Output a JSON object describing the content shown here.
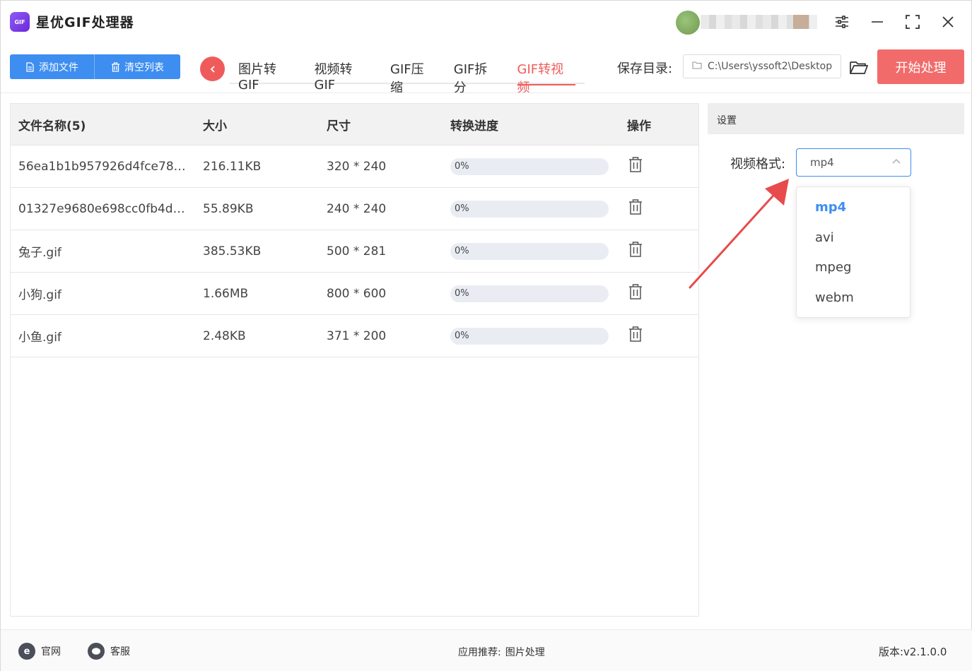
{
  "app": {
    "title": "星优GIF处理器",
    "logo_text": "GIF"
  },
  "toolbar": {
    "add_label": "添加文件",
    "clear_label": "清空列表",
    "tabs": [
      {
        "label": "图片转GIF",
        "active": false
      },
      {
        "label": "视频转GIF",
        "active": false
      },
      {
        "label": "GIF压缩",
        "active": false
      },
      {
        "label": "GIF拆分",
        "active": false
      },
      {
        "label": "GIF转视频",
        "active": true
      }
    ],
    "save_label": "保存目录:",
    "save_path": "C:\\Users\\yssoft2\\Desktop",
    "start_label": "开始处理"
  },
  "table": {
    "headers": {
      "name": "文件名称(5)",
      "size": "大小",
      "dim": "尺寸",
      "progress": "转换进度",
      "op": "操作"
    },
    "rows": [
      {
        "name": "56ea1b1b957926d4fce7820...",
        "size": "216.11KB",
        "dim": "320 * 240",
        "progress_text": "0%",
        "progress": 0
      },
      {
        "name": "01327e9680e698cc0fb4dd95...",
        "size": "55.89KB",
        "dim": "240 * 240",
        "progress_text": "0%",
        "progress": 0
      },
      {
        "name": "兔子.gif",
        "size": "385.53KB",
        "dim": "500 * 281",
        "progress_text": "0%",
        "progress": 0
      },
      {
        "name": "小狗.gif",
        "size": "1.66MB",
        "dim": "800 * 600",
        "progress_text": "0%",
        "progress": 0
      },
      {
        "name": "小鱼.gif",
        "size": "2.48KB",
        "dim": "371 * 200",
        "progress_text": "0%",
        "progress": 0
      }
    ]
  },
  "settings": {
    "header": "设置",
    "format_label": "视频格式:",
    "format_value": "mp4",
    "format_options": [
      "mp4",
      "avi",
      "mpeg",
      "webm"
    ]
  },
  "footer": {
    "website": "官网",
    "support": "客服",
    "recommend_label": "应用推荐:",
    "recommend_link": "图片处理",
    "version": "版本:v2.1.0.0"
  },
  "colors": {
    "accent_blue": "#3d8ef0",
    "accent_red": "#ef5b5b",
    "start_button": "#f26b6b"
  }
}
